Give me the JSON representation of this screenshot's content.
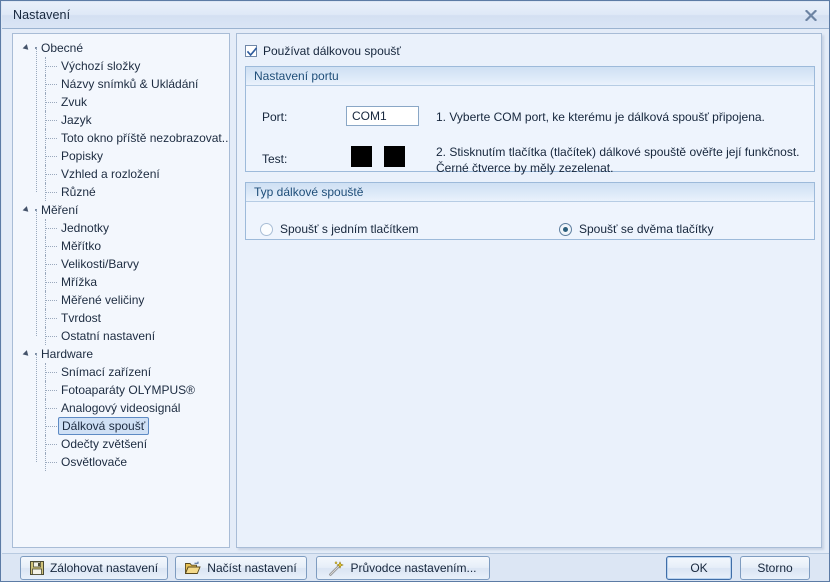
{
  "window": {
    "title": "Nastavení",
    "close_icon": "close-icon"
  },
  "sidebar": {
    "items": [
      {
        "label": "Obecné",
        "type": "group"
      },
      {
        "label": "Výchozí složky",
        "type": "child"
      },
      {
        "label": "Názvy snímků & Ukládání",
        "type": "child"
      },
      {
        "label": "Zvuk",
        "type": "child"
      },
      {
        "label": "Jazyk",
        "type": "child"
      },
      {
        "label": "Toto okno příště nezobrazovat...",
        "type": "child"
      },
      {
        "label": "Popisky",
        "type": "child"
      },
      {
        "label": "Vzhled a rozložení",
        "type": "child"
      },
      {
        "label": "Různé",
        "type": "child"
      },
      {
        "label": "Měření",
        "type": "group"
      },
      {
        "label": "Jednotky",
        "type": "child"
      },
      {
        "label": "Měřítko",
        "type": "child"
      },
      {
        "label": "Velikosti/Barvy",
        "type": "child"
      },
      {
        "label": "Mřížka",
        "type": "child"
      },
      {
        "label": "Měřené veličiny",
        "type": "child"
      },
      {
        "label": "Tvrdost",
        "type": "child"
      },
      {
        "label": "Ostatní nastavení",
        "type": "child"
      },
      {
        "label": "Hardware",
        "type": "group"
      },
      {
        "label": "Snímací zařízení",
        "type": "child"
      },
      {
        "label": "Fotoaparáty OLYMPUS®",
        "type": "child"
      },
      {
        "label": "Analogový videosignál",
        "type": "child"
      },
      {
        "label": "Dálková spoušť",
        "type": "child",
        "selected": true
      },
      {
        "label": "Odečty zvětšení",
        "type": "child"
      },
      {
        "label": "Osvětlovače",
        "type": "child"
      }
    ]
  },
  "main": {
    "enable_checkbox": {
      "label": "Používat dálkovou spoušť",
      "checked": true
    },
    "port_group": {
      "header": "Nastavení portu",
      "port_label": "Port:",
      "port_value": "COM1",
      "port_hint": "1. Vyberte COM port, ke kterému je dálková spoušť připojena.",
      "test_label": "Test:",
      "test_hint_line1": "2. Stisknutím tlačítka (tlačítek) dálkové spouště ověřte její funkčnost. Černé",
      "test_hint_line2": "čtverce by měly zezelenat.",
      "test_square_color": "#000000"
    },
    "type_group": {
      "header": "Typ dálkové spouště",
      "option_one": "Spoušť s jedním tlačítkem",
      "option_two": "Spoušť se dvěma tlačítky",
      "selected": "option_two"
    }
  },
  "footer": {
    "backup_label": "Zálohovat nastavení",
    "load_label": "Načíst nastavení",
    "wizard_label": "Průvodce nastavením...",
    "ok_label": "OK",
    "cancel_label": "Storno"
  },
  "colors": {
    "accent": "#1f4e79",
    "window_bg": "#dce6f4",
    "panel_bg": "#eaf1fb",
    "border": "#a8bcd6"
  }
}
